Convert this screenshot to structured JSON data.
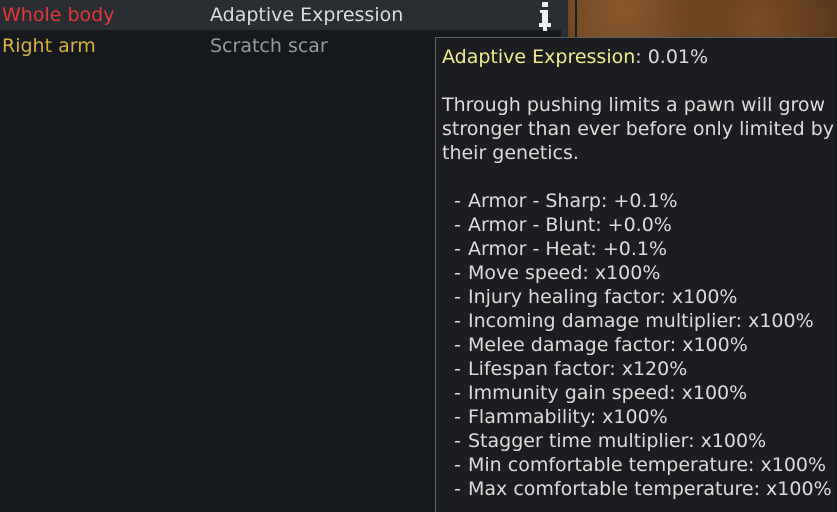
{
  "health": {
    "rows": [
      {
        "part": "Whole body",
        "condition": "Adaptive Expression",
        "part_color": "#e0393a",
        "condition_color": "#dcdcdc"
      },
      {
        "part": "Right arm",
        "condition": "Scratch scar",
        "part_color": "#d9b23a",
        "condition_color": "#9a9a9a"
      }
    ],
    "info_icon": "info-icon"
  },
  "tooltip": {
    "title": "Adaptive Expression",
    "title_suffix": ": 0.01%",
    "description": "Through pushing limits a pawn will grow stronger than ever before only limited by their genetics.",
    "stats": [
      "Armor - Sharp: +0.1%",
      "Armor - Blunt: +0.0%",
      "Armor - Heat: +0.1%",
      "Move speed: x100%",
      "Injury healing factor: x100%",
      "Incoming damage multiplier: x100%",
      "Melee damage factor: x100%",
      "Lifespan factor: x120%",
      "Immunity gain speed: x100%",
      "Flammability: x100%",
      "Stagger time multiplier: x100%",
      "Min comfortable temperature: x100%",
      "Max comfortable temperature: x100%"
    ]
  },
  "colors": {
    "background": "#15181c",
    "tooltip_title": "#f0ec8c",
    "tooltip_text": "#dcdcdc"
  }
}
